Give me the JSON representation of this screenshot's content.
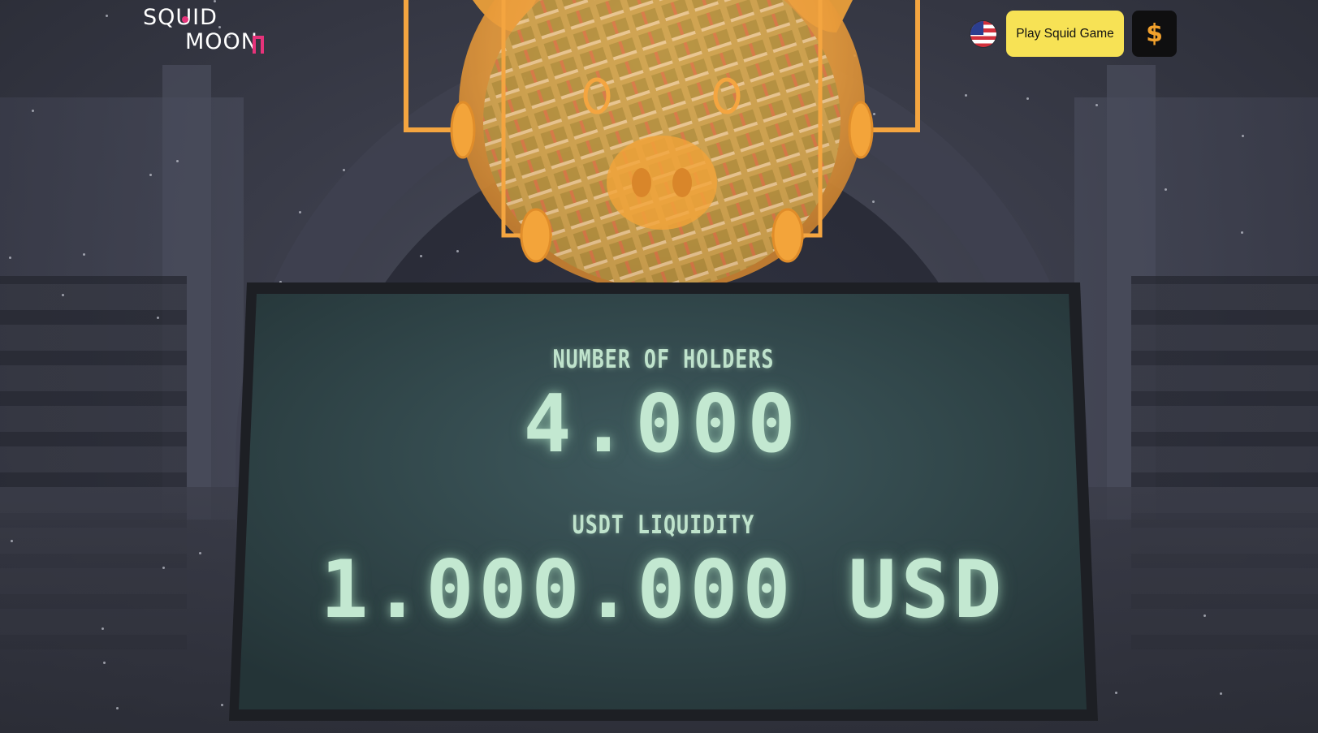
{
  "brand": {
    "logo_line1": "SQUID",
    "logo_line2": "MOON",
    "accent_color": "#e6337a"
  },
  "header": {
    "language_flag": "us-flag-icon",
    "play_button_label": "Play Squid Game",
    "play_button_color": "#f7e255",
    "buy_button_icon": "dollar-sign-icon",
    "buy_button_icon_color": "#f2a12c"
  },
  "stats": {
    "holders_label": "NUMBER OF HOLDERS",
    "holders_value": "4.000",
    "liquidity_label": "USDT LIQUIDITY",
    "liquidity_value": "1.000.000 USD",
    "text_color": "#c3e8d1"
  },
  "scene": {
    "piggy_bank_color": "#f3a43a",
    "board_color": "#34494f"
  }
}
